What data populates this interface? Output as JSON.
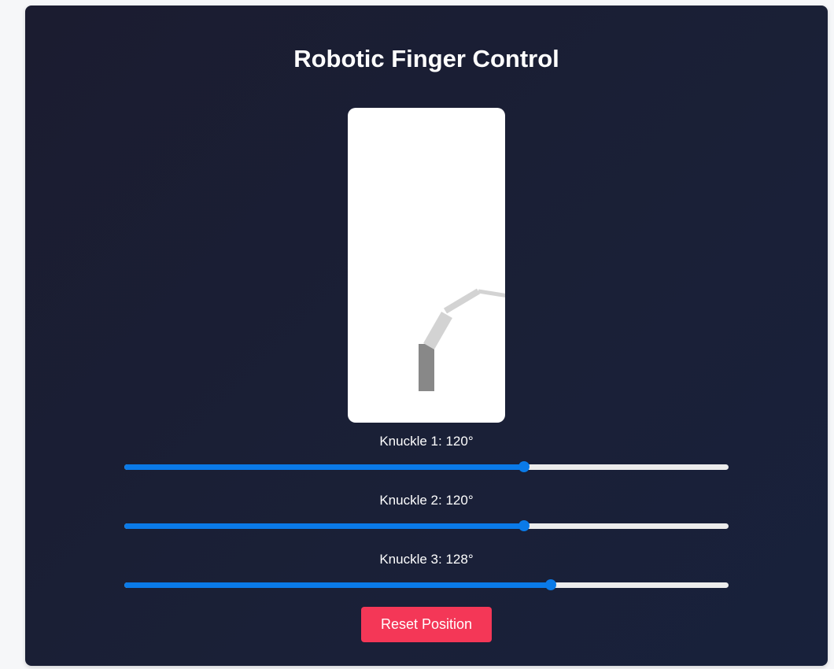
{
  "title": "Robotic Finger Control",
  "knuckles": [
    {
      "label": "Knuckle 1:",
      "angle": 120,
      "display": "120°",
      "fraction": 0.662
    },
    {
      "label": "Knuckle 2:",
      "angle": 120,
      "display": "120°",
      "fraction": 0.662
    },
    {
      "label": "Knuckle 3:",
      "angle": 128,
      "display": "128°",
      "fraction": 0.706
    }
  ],
  "reset_label": "Reset Position",
  "colors": {
    "background_panel": "#1a1f35",
    "slider_fill": "#0a7ae8",
    "slider_track": "#ececec",
    "reset_button": "#f43757",
    "finger_base": "#888888",
    "finger_segment": "#d3d3d3"
  }
}
